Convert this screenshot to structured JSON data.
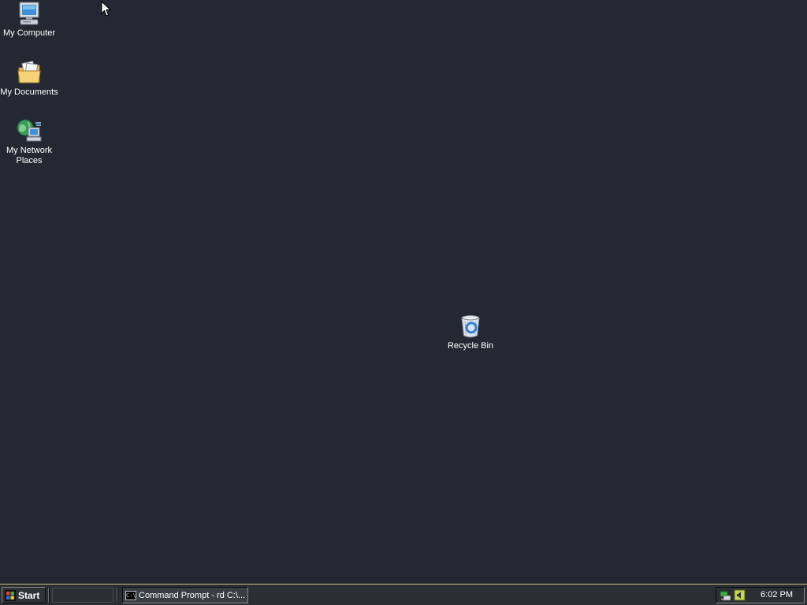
{
  "desktop": {
    "icons": [
      {
        "label": "My Computer",
        "icon": "computer-icon"
      },
      {
        "label": "My Documents",
        "icon": "folder-documents-icon"
      },
      {
        "label_line1": "My Network",
        "label_line2": "Places",
        "icon": "network-places-icon"
      },
      {
        "label": "Recycle Bin",
        "icon": "recycle-bin-icon"
      }
    ],
    "background_color": "#232832"
  },
  "taskbar": {
    "start_label": "Start",
    "tasks": [
      {
        "label": "Command Prompt - rd C:\\...",
        "icon": "command-prompt-icon",
        "icon_text": "C:\\"
      }
    ],
    "tray": {
      "icons": [
        "network-tray-icon",
        "volume-tray-icon"
      ],
      "clock": "6:02 PM"
    }
  }
}
